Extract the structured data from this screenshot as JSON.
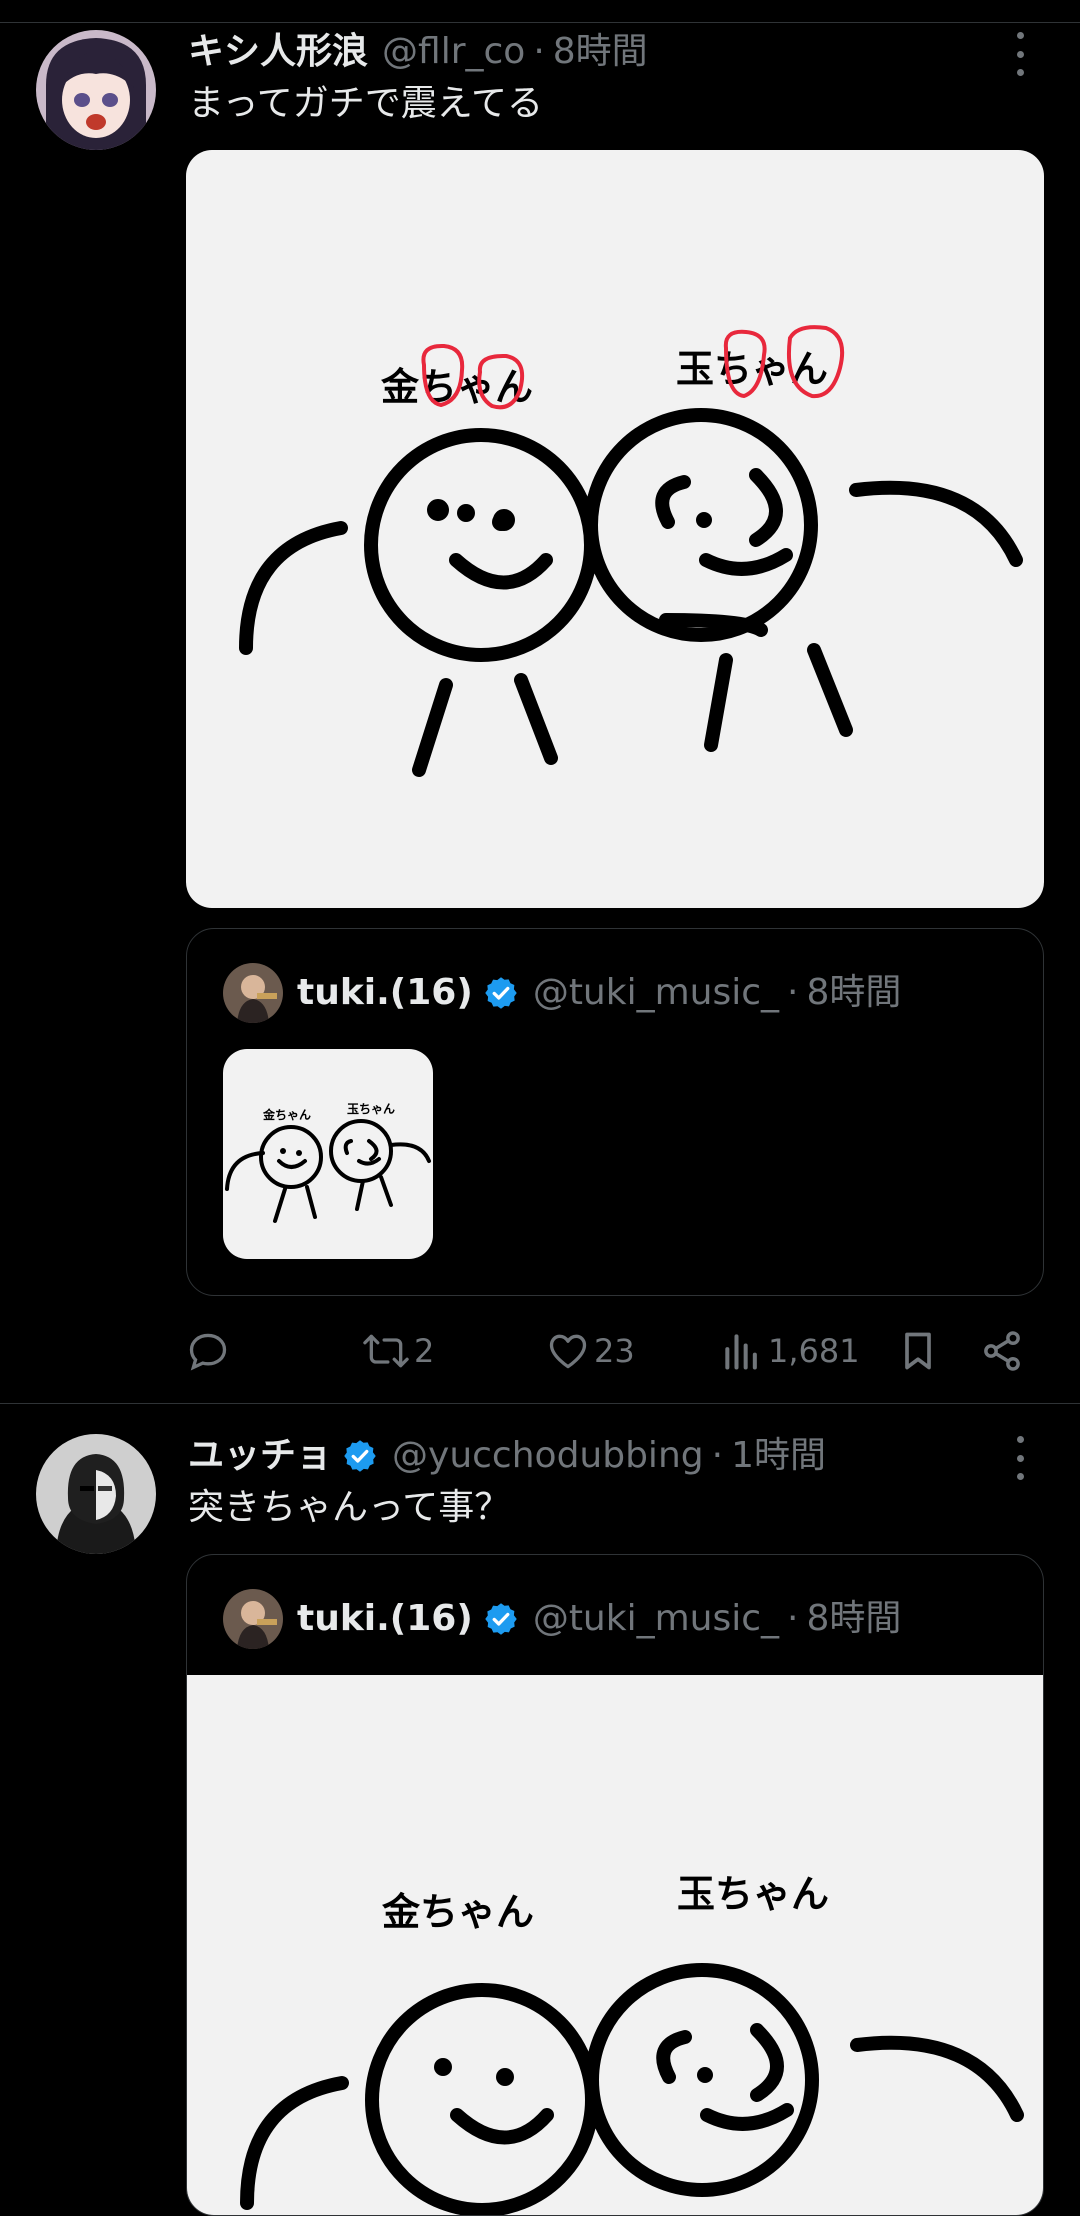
{
  "tweets": [
    {
      "name": "キシ人形浪",
      "handle": "@fllr_co",
      "separator": "·",
      "time": "8時間",
      "text": "まってガチで震えてる",
      "media": {
        "label_left": "金ちゃん",
        "label_right": "玉ちゃん"
      },
      "quote": {
        "name": "tuki.(16)",
        "handle": "@tuki_music_",
        "separator": "·",
        "time": "8時間",
        "thumb": {
          "label_left": "金ちゃん",
          "label_right": "玉ちゃん"
        }
      },
      "actions": {
        "reply_icon": "reply-icon",
        "retweet_count": "2",
        "like_count": "23",
        "views_count": "1,681"
      }
    },
    {
      "name": "ユッチョ",
      "handle": "@yucchodubbing",
      "separator": "·",
      "time": "1時間",
      "text": "突きちゃんって事？",
      "verified": true,
      "quote": {
        "name": "tuki.(16)",
        "handle": "@tuki_music_",
        "separator": "·",
        "time": "8時間",
        "media": {
          "label_left": "金ちゃん",
          "label_right": "玉ちゃん"
        }
      }
    }
  ],
  "colors": {
    "background": "#000000",
    "text_primary": "#e7e9ea",
    "text_secondary": "#71767b",
    "verified_blue": "#1d9bf0",
    "divider": "#2f3336",
    "media_bg": "#f2f2f2",
    "highlight_red": "#e8283c"
  }
}
